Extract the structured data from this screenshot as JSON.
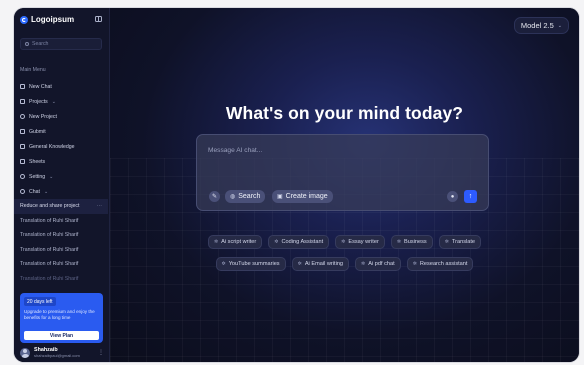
{
  "sidebar": {
    "brand": "Logoipsum",
    "search_placeholder": "Search",
    "section_label": "Main Menu",
    "items": [
      {
        "label": "New Chat",
        "caret": ""
      },
      {
        "label": "Projects",
        "caret": "⌄"
      },
      {
        "label": "New Project",
        "caret": ""
      },
      {
        "label": "Gubmit",
        "caret": ""
      },
      {
        "label": "General Knowledge",
        "caret": ""
      },
      {
        "label": "Sheets",
        "caret": ""
      },
      {
        "label": "Setting",
        "caret": "⌄"
      },
      {
        "label": "Chat",
        "caret": "⌄"
      }
    ],
    "history": [
      {
        "label": "Reduce and share project",
        "more": "···"
      },
      {
        "label": "Translation of Ruhi Sharif"
      },
      {
        "label": "Translation of Ruhi Sharif"
      },
      {
        "label": "Translation of Ruhi Sharif"
      },
      {
        "label": "Translation of Ruhi Sharif"
      },
      {
        "label": "Translation of Ruhi Sharif"
      }
    ],
    "upgrade": {
      "badge": "20 days left",
      "text": "Upgrade to premium and enjoy the benefits for a long time",
      "button": "View Plan"
    },
    "profile": {
      "name": "Shahzaib",
      "email": "shahzaibpaul@gmail.com",
      "more": "⋮"
    }
  },
  "main": {
    "model_select": "Model 2.5",
    "headline": "What's on your mind today?",
    "composer": {
      "placeholder": "Message AI chat...",
      "search_label": "Search",
      "create_image_label": "Create image"
    },
    "suggestions_row1": [
      "Ai script writer",
      "Coding Assistant",
      "Essay writer",
      "Business",
      "Translate"
    ],
    "suggestions_row2": [
      "YouTube summaries",
      "Ai Email writing",
      "Ai pdf chat",
      "Research assistant"
    ]
  },
  "colors": {
    "accent": "#2d5bff",
    "sidebar_bg": "#12152a",
    "upgrade_bg": "#2a5bf0"
  }
}
